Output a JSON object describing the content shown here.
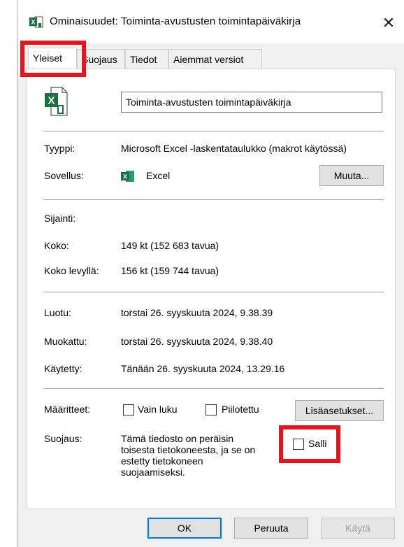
{
  "window": {
    "title": "Ominaisuudet: Toiminta-avustusten toimintapäiväkirja",
    "close_glyph": "✕"
  },
  "tabs": [
    {
      "label": "Yleiset",
      "active": true
    },
    {
      "label": "Suojaus",
      "active": false
    },
    {
      "label": "Tiedot",
      "active": false
    },
    {
      "label": "Aiemmat versiot",
      "active": false
    }
  ],
  "general": {
    "file_name": "Toiminta-avustusten toimintapäiväkirja",
    "type_label": "Tyyppi:",
    "type_value": "Microsoft Excel -laskentataulukko (makrot käytössä)",
    "app_label": "Sovellus:",
    "app_value": "Excel",
    "change_button": "Muuta...",
    "location_label": "Sijainti:",
    "location_value": "",
    "size_label": "Koko:",
    "size_value": "149 kt (152 683 tavua)",
    "size_on_disk_label": "Koko levyllä:",
    "size_on_disk_value": "156 kt (159 744 tavua)",
    "created_label": "Luotu:",
    "created_value": "torstai 26. syyskuuta 2024, 9.38.39",
    "modified_label": "Muokattu:",
    "modified_value": "torstai 26. syyskuuta 2024, 9.38.40",
    "accessed_label": "Käytetty:",
    "accessed_value": "Tänään 26. syyskuuta 2024, 13.29.16",
    "attributes_label": "Määritteet:",
    "readonly_label": "Vain luku",
    "readonly_checked": false,
    "hidden_label": "Piilotettu",
    "hidden_checked": false,
    "advanced_button": "Lisäasetukset...",
    "security_label": "Suojaus:",
    "security_text_lines": [
      "Tämä tiedosto on peräisin",
      "toisesta tietokoneesta, ja se on",
      "estetty tietokoneen",
      "suojaamiseksi."
    ],
    "unblock_label": "Salli",
    "unblock_checked": false
  },
  "footer": {
    "ok_button": "OK",
    "cancel_button": "Peruuta",
    "apply_button": "Käytä"
  },
  "colors": {
    "excel_green": "#1d6f42",
    "highlight_red": "#e8141c",
    "focus_blue": "#0078d7"
  },
  "icons": {
    "title": "excel-file-icon",
    "file": "excel-file-icon",
    "app": "excel-app-icon",
    "close": "close-icon"
  }
}
